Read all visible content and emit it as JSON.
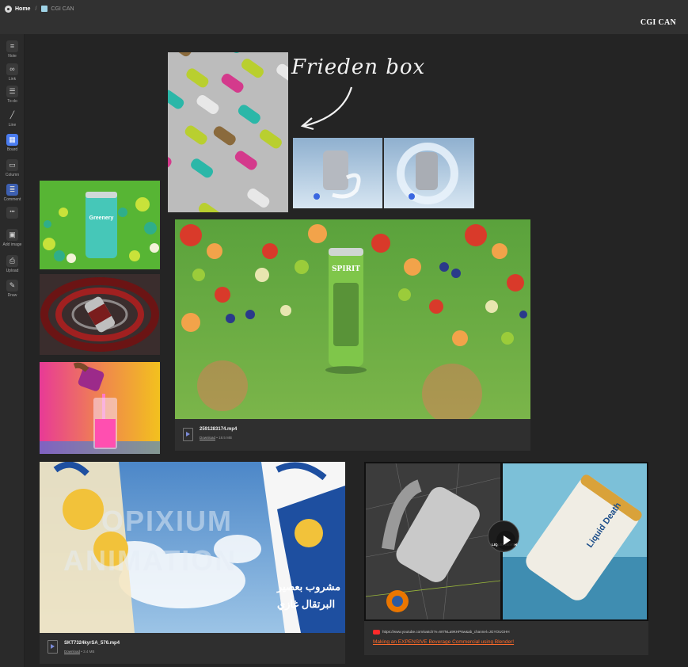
{
  "breadcrumb": {
    "home": "Home",
    "separator": "/",
    "board": "CGI CAN"
  },
  "board_title": "CGI CAN",
  "sidebar": {
    "tools": [
      {
        "label": "Note",
        "icon": "note-icon",
        "glyph": "≡"
      },
      {
        "label": "Link",
        "icon": "link-icon",
        "glyph": "∞"
      },
      {
        "label": "To-do",
        "icon": "todo-icon",
        "glyph": "☰"
      },
      {
        "label": "Line",
        "icon": "line-icon",
        "glyph": "╱"
      },
      {
        "label": "Board",
        "icon": "board-icon",
        "glyph": "▦"
      },
      {
        "label": "Column",
        "icon": "column-icon",
        "glyph": "▭"
      },
      {
        "label": "Comment",
        "icon": "comment-icon",
        "glyph": "≣"
      },
      {
        "label": "",
        "icon": "more-icon",
        "glyph": "•••"
      },
      {
        "label": "Add image",
        "icon": "add-image-icon",
        "glyph": "▣"
      },
      {
        "label": "Upload",
        "icon": "upload-icon",
        "glyph": "⎙"
      },
      {
        "label": "Draw",
        "icon": "draw-icon",
        "glyph": "✎"
      }
    ]
  },
  "sketch_note": "Frieden box",
  "video1": {
    "filename": "2591283174.mp4",
    "download": "Download",
    "size": "• 18.5 MB"
  },
  "video2": {
    "filename": "SKT7324kyrSA_576.mp4",
    "download": "Download",
    "size": "• 3.4 MB"
  },
  "youtube": {
    "url": "https://www.youtube.com/watch?v=W7NLa9KHP6w&ab_channel=JGYOUGHH",
    "title": "Making an EXPENSIVE Beverage Commercial using Blender!"
  },
  "image_texts": {
    "greenery": "Greenery",
    "spirit": "SPIRIT",
    "opixium": "OPIXIUM",
    "animation": "ANIMATION",
    "arabic_line1": "مشروب بعصير",
    "arabic_line2": "البرتقال غازي",
    "liquid_death": "LIQUID DEATH",
    "liquid_can": "Liquid Death"
  },
  "colors": {
    "accent": "#4a7cf0",
    "youtube_red": "#ff2a2a",
    "link_orange": "#ff6a2a"
  }
}
